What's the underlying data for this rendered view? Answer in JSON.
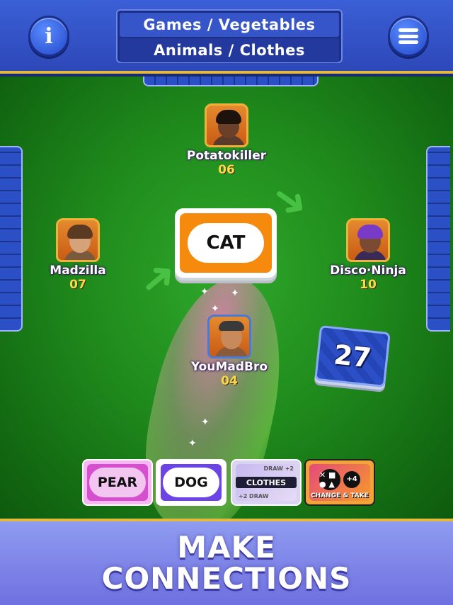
{
  "header": {
    "info_icon": "info-icon",
    "menu_icon": "hamburger-menu-icon",
    "categories": {
      "top": "Games / Vegetables",
      "bottom": "Animals / Clothes"
    }
  },
  "players": {
    "top": {
      "name": "Potatokiller",
      "score": "06"
    },
    "left": {
      "name": "Madzilla",
      "score": "07"
    },
    "right": {
      "name": "Disco·Ninja",
      "score": "10"
    },
    "self": {
      "name": "YouMadBro",
      "score": "04"
    }
  },
  "table": {
    "center_card_word": "CAT",
    "deck_count": "27",
    "colors": {
      "felt": "#1f8a1c",
      "card_back": "#2b4fc4",
      "accent_gold": "#e3b93f"
    }
  },
  "hand": {
    "cards": [
      {
        "word": "PEAR",
        "color": "#d64fcf"
      },
      {
        "word": "DOG",
        "color": "#6b43e6"
      },
      {
        "type": "draw",
        "top_label": "DRAW +2",
        "category": "CLOTHES",
        "bottom_label": "+2 DRAW"
      },
      {
        "type": "change",
        "plus": "+4",
        "label": "CHANGE & TAKE",
        "symbols": "✕ ■ ● ▲"
      }
    ]
  },
  "banner": {
    "line1": "MAKE",
    "line2": "CONNECTIONS"
  }
}
